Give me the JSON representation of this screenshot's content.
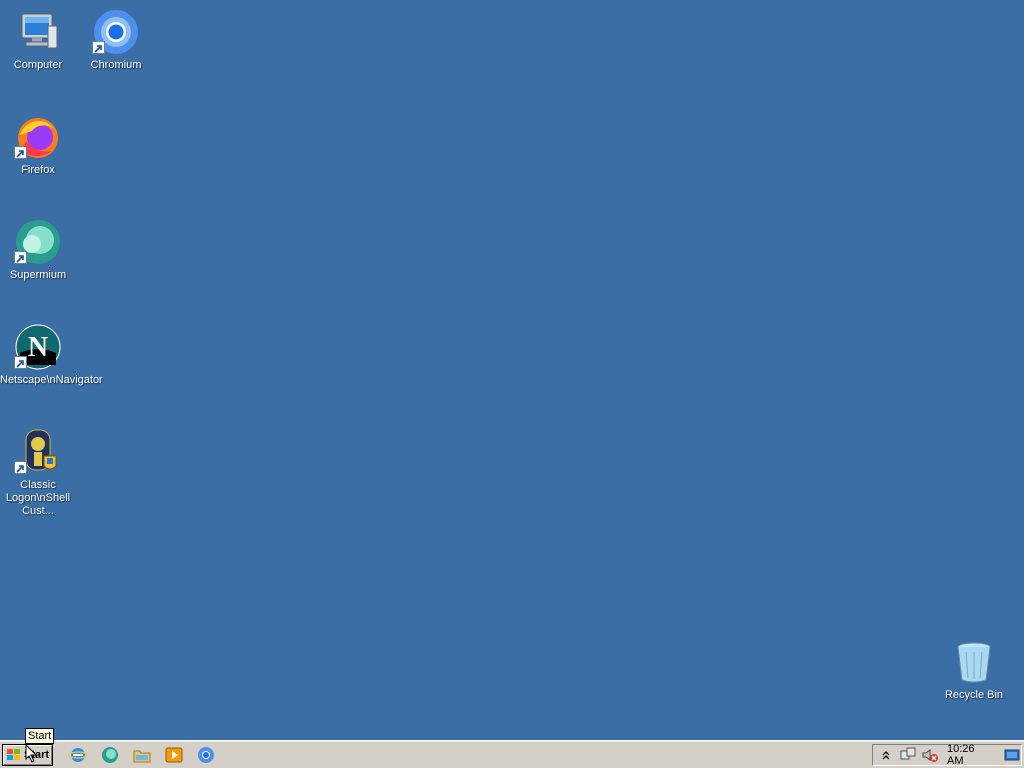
{
  "desktop": {
    "icons": [
      {
        "id": "computer",
        "label": "Computer"
      },
      {
        "id": "chromium",
        "label": "Chromium"
      },
      {
        "id": "firefox",
        "label": "Firefox"
      },
      {
        "id": "supermium",
        "label": "Supermium"
      },
      {
        "id": "netscape",
        "label": "Netscape\\nNavigator"
      },
      {
        "id": "classic-logon",
        "label": "Classic Logon\\nShell Cust..."
      },
      {
        "id": "recycle-bin",
        "label": "Recycle Bin"
      }
    ]
  },
  "taskbar": {
    "start_label": "Start",
    "tooltip": "Start",
    "quick_launch": [
      "ie-icon",
      "supermium-icon",
      "explorer-icon",
      "media-player-icon",
      "chromium-icon"
    ],
    "tray": [
      "show-hidden-icon",
      "network-icon",
      "volume-muted-icon",
      "desktop-icon"
    ],
    "clock": "10:26 AM"
  },
  "colors": {
    "desktop": "#3b6ea5",
    "taskbar": "#d4d0c8"
  }
}
